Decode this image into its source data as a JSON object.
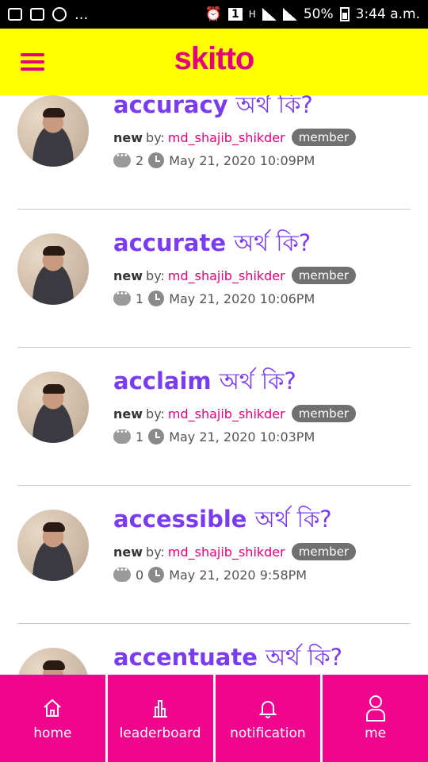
{
  "status_bar": {
    "notifications_more": "...",
    "sim_label": "1",
    "signal_label": "H",
    "battery": "50%",
    "time": "3:44 a.m."
  },
  "header": {
    "logo": "skitto",
    "menu_icon": "hamburger-menu-icon"
  },
  "feed": {
    "items": [
      {
        "word": "accuracy",
        "suffix": "অর্থ কি?",
        "status": "new",
        "by": "by:",
        "user": "md_shajib_shikder",
        "badge": "member",
        "comments": "2",
        "datetime": "May 21, 2020 10:09PM"
      },
      {
        "word": "accurate",
        "suffix": "অর্থ কি?",
        "status": "new",
        "by": "by:",
        "user": "md_shajib_shikder",
        "badge": "member",
        "comments": "1",
        "datetime": "May 21, 2020 10:06PM"
      },
      {
        "word": "acclaim",
        "suffix": "অর্থ কি?",
        "status": "new",
        "by": "by:",
        "user": "md_shajib_shikder",
        "badge": "member",
        "comments": "1",
        "datetime": "May 21, 2020 10:03PM"
      },
      {
        "word": "accessible",
        "suffix": "অর্থ কি?",
        "status": "new",
        "by": "by:",
        "user": "md_shajib_shikder",
        "badge": "member",
        "comments": "0",
        "datetime": "May 21, 2020 9:58PM"
      },
      {
        "word": "accentuate",
        "suffix": "অর্থ কি?",
        "status": "",
        "by": "",
        "user": "",
        "badge": "",
        "comments": "",
        "datetime": ""
      }
    ]
  },
  "bottom_nav": {
    "home": "home",
    "leaderboard": "leaderboard",
    "notification": "notification",
    "me": "me"
  },
  "colors": {
    "brand_pink": "#f0058f",
    "header_yellow": "#ffff00",
    "title_purple": "#7a3cf0",
    "badge_gray": "#707070"
  }
}
